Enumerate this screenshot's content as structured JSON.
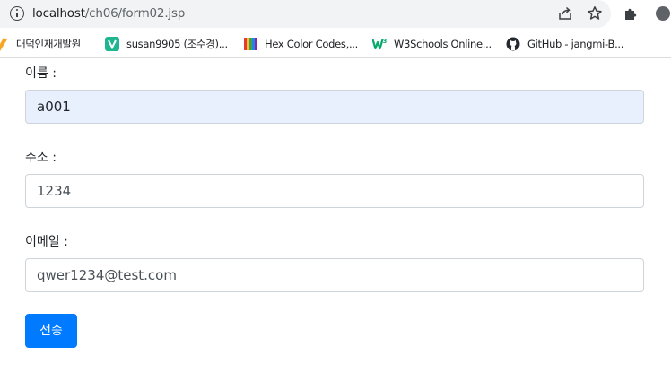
{
  "browser": {
    "url_host": "localhost",
    "url_path": "/ch06/form02.jsp",
    "icons": [
      "info-icon",
      "share-icon",
      "star-icon",
      "extensions-puzzle-icon",
      "profile-icon"
    ]
  },
  "bookmarks": [
    {
      "label": "대덕인재개발원",
      "icon": "dd-favicon",
      "color": "#f5a623"
    },
    {
      "label": "susan9905 (조수경)...",
      "icon": "v-favicon",
      "color": "#1fb58f"
    },
    {
      "label": "Hex Color Codes,...",
      "icon": "color-bars-favicon",
      "color": "#e53935"
    },
    {
      "label": "W3Schools Online...",
      "icon": "w3schools-favicon",
      "color": "#04aa6d"
    },
    {
      "label": "GitHub - jangmi-B...",
      "icon": "github-favicon",
      "color": "#24292f"
    }
  ],
  "form": {
    "name_label": "이름 :",
    "name_value": "a001",
    "address_label": "주소 :",
    "address_value": "1234",
    "email_label": "이메일 :",
    "email_value": "qwer1234@test.com",
    "submit_label": "전송"
  },
  "colors": {
    "primary": "#007bff",
    "autofill": "#e8f0fe",
    "border": "#ced4da"
  }
}
